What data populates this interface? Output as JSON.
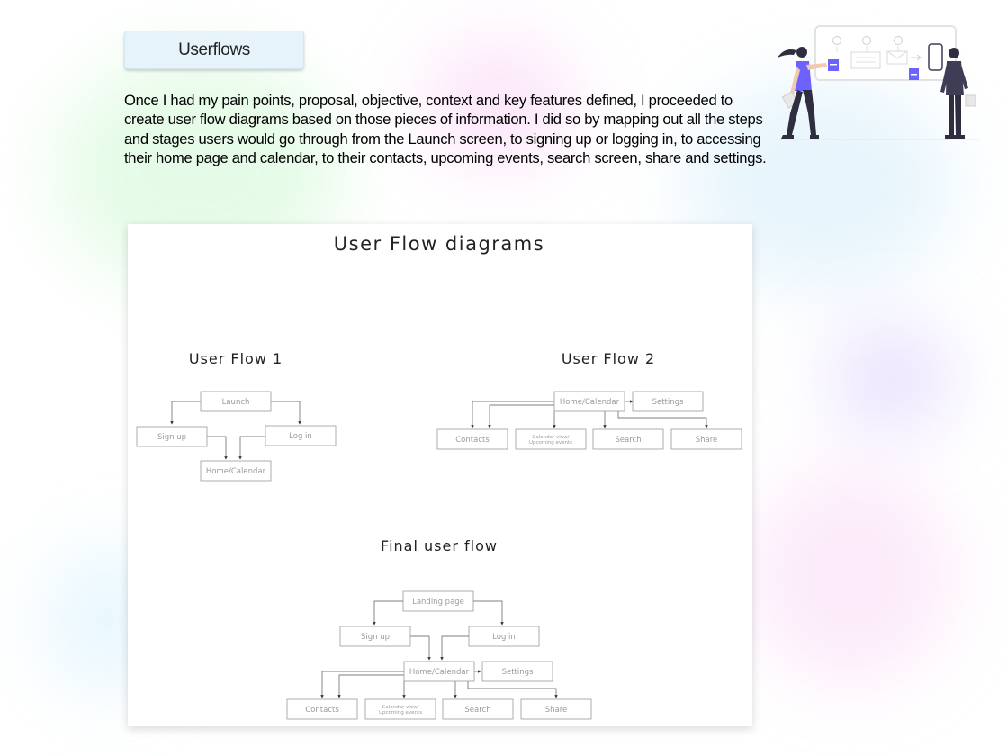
{
  "header": {
    "section_label": "Userflows"
  },
  "intro": {
    "paragraph": "Once I had my pain points, proposal, objective, context and key features defined, I proceeded to create user flow diagrams based on those pieces of information. I did so by mapping out all the steps and stages users would go through from the Launch screen, to signing up or logging in, to accessing their home page and calendar, to their contacts, upcoming events, search screen, share and settings."
  },
  "diagram": {
    "title": "User Flow diagrams",
    "flow1": {
      "title": "User Flow 1",
      "nodes": {
        "launch": "Launch",
        "signup": "Sign up",
        "login": "Log in",
        "home": "Home/Calendar"
      }
    },
    "flow2": {
      "title": "User Flow 2",
      "nodes": {
        "home": "Home/Calendar",
        "settings": "Settings",
        "contacts": "Contacts",
        "calendar_view_1": "Calendar view/",
        "calendar_view_2": "Upcoming events",
        "search": "Search",
        "share": "Share"
      }
    },
    "final": {
      "title": "Final user flow",
      "nodes": {
        "landing": "Landing page",
        "signup": "Sign up",
        "login": "Log in",
        "home": "Home/Calendar",
        "settings": "Settings",
        "contacts": "Contacts",
        "calendar_view_1": "Calendar view/",
        "calendar_view_2": "Upcoming events",
        "search": "Search",
        "share": "Share"
      }
    }
  },
  "colors": {
    "accent": "#6c63ff",
    "pill_bg": "#e6f3fb",
    "node_border": "#9a9a9a",
    "node_text": "#9a9a9a"
  }
}
